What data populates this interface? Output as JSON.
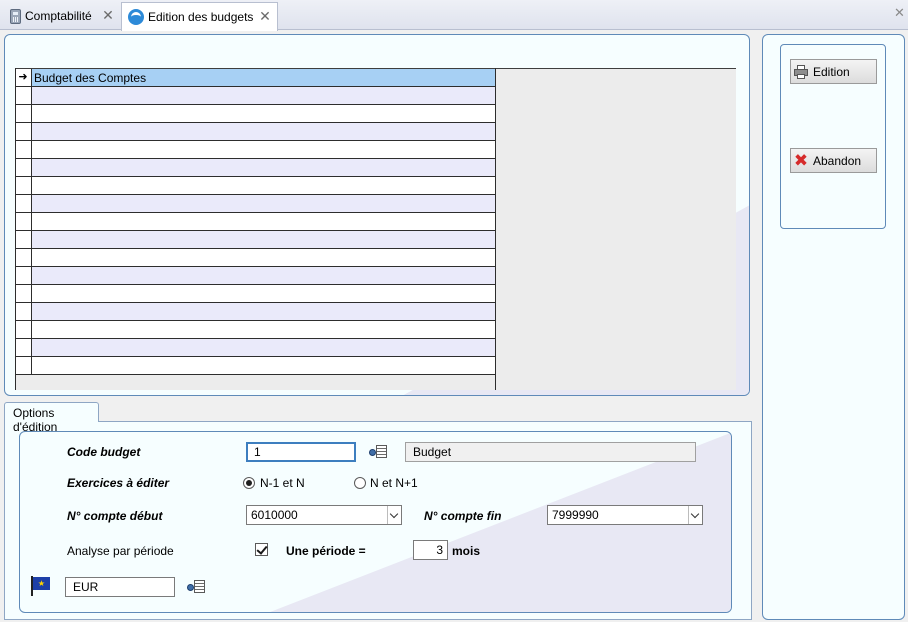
{
  "tabs": [
    {
      "label": "Comptabilité",
      "icon": "calculator-icon",
      "active": false
    },
    {
      "label": "Edition des budgets",
      "icon": "app-logo-icon",
      "active": true
    }
  ],
  "grid": {
    "rows": [
      "Budget des Comptes",
      "",
      "",
      "",
      "",
      "",
      "",
      "",
      "",
      "",
      "",
      "",
      "",
      "",
      "",
      "",
      "",
      ""
    ],
    "selected_index": 0,
    "row_indicator": "➜"
  },
  "options": {
    "tab_label": "Options d'édition",
    "code_budget": {
      "label": "Code budget",
      "value": "1",
      "description": "Budget"
    },
    "exercices": {
      "label": "Exercices à éditer",
      "options": [
        "N-1 et N",
        "N et N+1"
      ],
      "selected": "N-1 et N"
    },
    "compte_debut": {
      "label": "N° compte début",
      "value": "6010000"
    },
    "compte_fin": {
      "label": "N° compte fin",
      "value": "7999990"
    },
    "analyse": {
      "label": "Analyse par période",
      "checked": true
    },
    "periode": {
      "label": "Une période =",
      "value": "3",
      "unit": "mois"
    },
    "devise": {
      "value": "EUR",
      "icon": "eu-flag-icon"
    }
  },
  "buttons": {
    "edition": "Edition",
    "abandon": "Abandon"
  },
  "colors": {
    "panel_border": "#5f8ab8",
    "panel_bg": "#f6feff",
    "selected_row": "#a7d0f4",
    "alt_row": "#eaeafa"
  }
}
